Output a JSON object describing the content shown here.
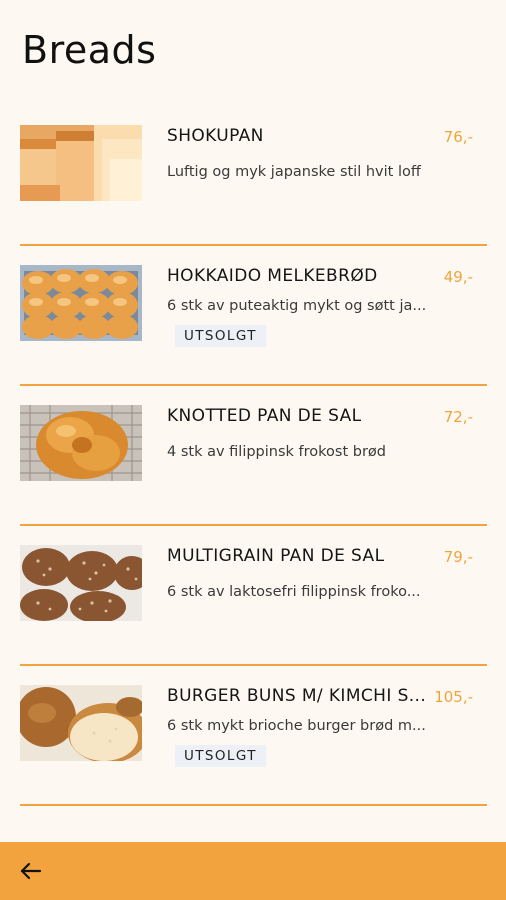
{
  "page": {
    "title": "Breads"
  },
  "items": [
    {
      "name": "SHOKUPAN",
      "price": "76,-",
      "description": "Luftig og myk japanske stil hvit loff",
      "badge": ""
    },
    {
      "name": "HOKKAIDO MELKEBRØD",
      "price": "49,-",
      "description": "6 stk av puteaktig mykt og søtt ja...",
      "badge": "UTSOLGT"
    },
    {
      "name": "KNOTTED PAN DE SAL",
      "price": "72,-",
      "description": "4 stk av filippinsk frokost brød",
      "badge": ""
    },
    {
      "name": "MULTIGRAIN PAN DE SAL",
      "price": "79,-",
      "description": "6 stk av laktosefri filippinsk froko...",
      "badge": ""
    },
    {
      "name": "BURGER BUNS M/ KIMCHI S...",
      "price": "105,-",
      "description": "6 stk mykt brioche burger brød m...",
      "badge": "UTSOLGT"
    }
  ],
  "icons": {
    "back": "arrow-left-icon"
  },
  "colors": {
    "accent": "#f3a33e",
    "price": "#f0a43c",
    "background": "#fdf9f2",
    "badge_bg": "#eef0f8"
  }
}
